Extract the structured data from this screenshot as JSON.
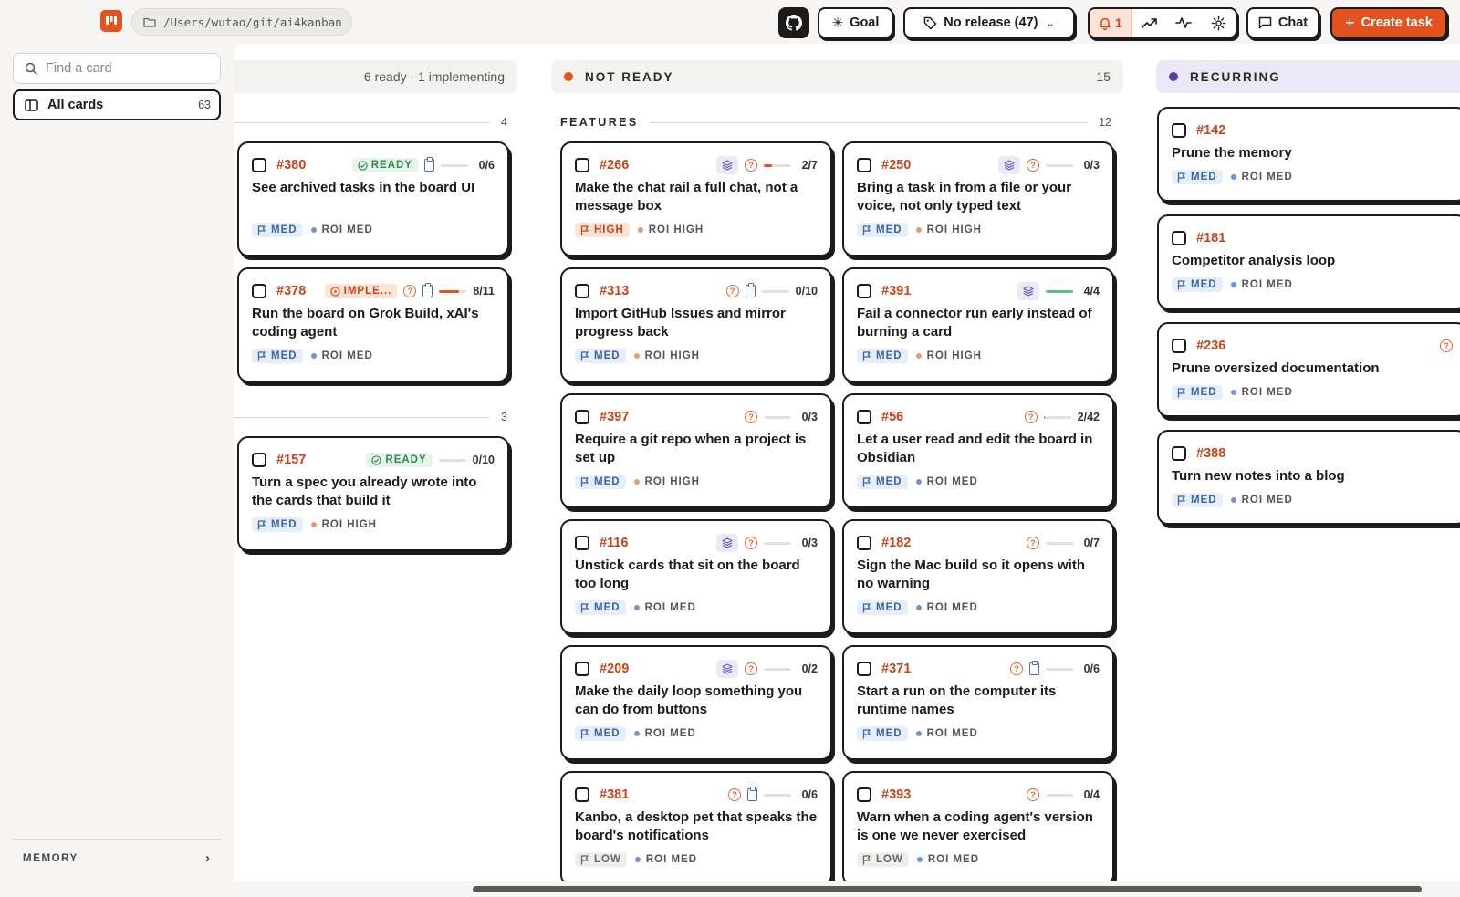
{
  "app": {
    "path": "/Users/wutao/git/ai4kanban"
  },
  "toolbar": {
    "goal_label": "Goal",
    "release_label": "No release (47)",
    "notifications_count": "1",
    "chat_label": "Chat",
    "create_label": "Create task"
  },
  "sidebar": {
    "search_placeholder": "Find a card",
    "all_cards_label": "All cards",
    "all_cards_count": "63",
    "memory_label": "MEMORY"
  },
  "colors": {
    "accent": "#e2531f",
    "not_ready_dot": "#e2531f",
    "recurring_dot": "#5b3fa8",
    "ready_green": "#2f8a4d",
    "med_blue": "#3a63a8"
  },
  "columns": {
    "ready": {
      "summary": "6 ready · 1 implementing",
      "groups": [
        {
          "count": "4",
          "cards": [
            {
              "id": "#380",
              "badge": "READY",
              "clip": true,
              "progress": 0.0,
              "count": "0/6",
              "title": "See archived tasks in the board UI",
              "priority": "MED",
              "roi": "ROI MED"
            },
            {
              "id": "#378",
              "badge": "IMPLE...",
              "question": true,
              "clip": true,
              "progress": 0.73,
              "progress_color": "#e2531f",
              "count": "8/11",
              "title": "Run the board on Grok Build, xAI's coding agent",
              "priority": "MED",
              "roi": "ROI MED"
            }
          ]
        },
        {
          "count": "3",
          "cards": [
            {
              "id": "#157",
              "badge": "READY",
              "progress": 0.0,
              "count": "0/10",
              "title": "Turn a spec you already wrote into the cards that build it",
              "priority": "MED",
              "roi": "ROI HIGH"
            }
          ]
        }
      ]
    },
    "not_ready": {
      "title": "NOT READY",
      "count": "15",
      "section_name": "FEATURES",
      "section_count": "12",
      "cards": [
        {
          "id": "#266",
          "stack": true,
          "question": true,
          "progress": 0.29,
          "progress_color": "#e2531f",
          "count": "2/7",
          "title": "Make the chat rail a full chat, not a message box",
          "priority": "HIGH",
          "roi": "ROI HIGH"
        },
        {
          "id": "#250",
          "stack": true,
          "question": true,
          "progress": 0.0,
          "count": "0/3",
          "title": "Bring a task in from a file or your voice, not only typed text",
          "priority": "MED",
          "roi": "ROI HIGH"
        },
        {
          "id": "#313",
          "question": true,
          "clip": true,
          "progress": 0.0,
          "count": "0/10",
          "title": "Import GitHub Issues and mirror progress back",
          "priority": "MED",
          "roi": "ROI HIGH"
        },
        {
          "id": "#391",
          "stack": true,
          "progress": 1.0,
          "progress_color": "#5cbf86",
          "count": "4/4",
          "title": "Fail a connector run early instead of burning a card",
          "priority": "MED",
          "roi": "ROI HIGH"
        },
        {
          "id": "#397",
          "question": true,
          "progress": 0.0,
          "count": "0/3",
          "title": "Require a git repo when a project is set up",
          "priority": "MED",
          "roi": "ROI HIGH"
        },
        {
          "id": "#56",
          "question": true,
          "progress": 0.05,
          "progress_color": "#e2531f",
          "count": "2/42",
          "title": "Let a user read and edit the board in Obsidian",
          "priority": "MED",
          "roi": "ROI MED"
        },
        {
          "id": "#116",
          "stack": true,
          "question": true,
          "progress": 0.0,
          "count": "0/3",
          "title": "Unstick cards that sit on the board too long",
          "priority": "MED",
          "roi": "ROI MED"
        },
        {
          "id": "#182",
          "question": true,
          "progress": 0.0,
          "count": "0/7",
          "title": "Sign the Mac build so it opens with no warning",
          "priority": "MED",
          "roi": "ROI MED"
        },
        {
          "id": "#209",
          "stack": true,
          "question": true,
          "progress": 0.0,
          "count": "0/2",
          "title": "Make the daily loop something you can do from buttons",
          "priority": "MED",
          "roi": "ROI MED"
        },
        {
          "id": "#371",
          "question": true,
          "clip": true,
          "progress": 0.0,
          "count": "0/6",
          "title": "Start a run on the computer its runtime names",
          "priority": "MED",
          "roi": "ROI MED"
        },
        {
          "id": "#381",
          "question": true,
          "clip": true,
          "progress": 0.0,
          "count": "0/6",
          "title": "Kanbo, a desktop pet that speaks the board's notifications",
          "priority": "LOW",
          "roi": "ROI MED"
        },
        {
          "id": "#393",
          "question": true,
          "progress": 0.0,
          "count": "0/4",
          "title": "Warn when a coding agent's version is one we never exercised",
          "priority": "LOW",
          "roi": "ROI MED"
        }
      ]
    },
    "recurring": {
      "title": "RECURRING",
      "cards": [
        {
          "id": "#142",
          "title": "Prune the memory",
          "priority": "MED",
          "roi": "ROI MED"
        },
        {
          "id": "#181",
          "title": "Competitor analysis loop",
          "priority": "MED",
          "roi": "ROI MED"
        },
        {
          "id": "#236",
          "question": true,
          "title": "Prune oversized documentation",
          "priority": "MED",
          "roi": "ROI MED"
        },
        {
          "id": "#388",
          "title": "Turn new notes into a blog",
          "priority": "MED",
          "roi": "ROI MED"
        }
      ]
    }
  }
}
